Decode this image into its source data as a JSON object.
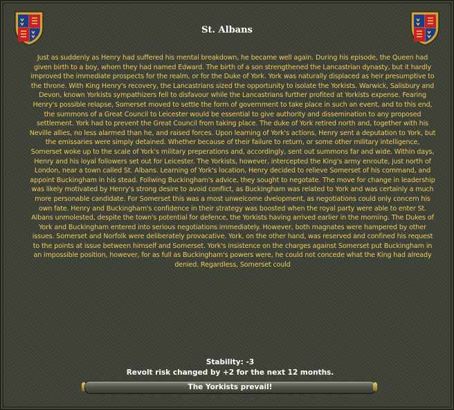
{
  "event": {
    "title": "St. Albans",
    "description": "Just as suddenly as Henry had suffered his mental breakdown, he became well again. During his episode, the Queen had given birth to a boy, whom they had named Edward. The birth of a son strengthened the Lancastrian dynasty, but it hardly improved the immediate prospects for the realm, or for the Duke of York. York was naturally displaced as heir presumptive to the throne. With King Henry's recovery, the Lancastrians sized the opportunity to isolate the Yorkists. Warwick, Salisbury and Devon, known Yorkists sympathizers fell to disfavour while the Lancastrians further profited at Yorkists expense. Fearing Henry's possible relapse, Somerset moved to settle the form of government to take place in such an event, and to this end, the summons of a Great Council to Leicester would be essential to give authority and dissemination to any proposed settlement. York had to prevent the Great Council from taking place. The duke of York retired north and, together with his Neville allies, no less alarmed than he, and raised forces. Upon learning of York's actions, Henry sent a deputation to York, but the emissaries were simply detained. Whether because of their failure to return, or some other military intelligence, Somerset woke up to the scale of York's military preperations and, accordingly, sent out summons far and wide. Within days, Henry and his loyal followers set out for Leicester. The Yorkists, however, intercepted the King's army enroute, just north of London, near a town called St. Albans. Learning of York's location, Henry decided to relieve Somerset of his command, and appoint Buckingham in his stead. Follwing Buckingham's advice, they sought to negotate. The move for change in leadership was likely motivated by Henry's strong desire to avoid conflict, as Buckingham was related to York and was certainly a much more personable candidate. For Somerset this was a most unwelcome dvelopment, as negotiations could only concern his own fate. Henry and Buckingham's confidence in their strategy was boosted when the royal party were able to enter St. Albans unmolested, despite the town's potential for defence, the Yorkists having arrived earlier in the morning. The Dukes of York and Buckingham entered into serious negotiations immediately. However, both magnates were hampered by other issues. Somerset and Norfolk were deliberately provacative. York, on the other hand, was reserved and confined his request to the points at issue between himself and Somerset. York's insistence on the charges against Somerset put Buckingham in an impossible position, however, for as full as Buckingham's powers were, he could not concede what the King had already denied. Regardless, Somerset could",
    "stability": "Stability: -3",
    "revolt": "Revolt risk changed by +2 for the next 12 months.",
    "option": "The Yorkists prevail!"
  },
  "icons": {
    "left_shield": "royal-coat-of-arms-icon",
    "right_shield": "royal-coat-of-arms-icon",
    "scroll_up": "scroll-up-knob-icon"
  },
  "colors": {
    "text_gold": "#f0c860",
    "background": "#3e4236",
    "title_white": "#ffffff"
  }
}
